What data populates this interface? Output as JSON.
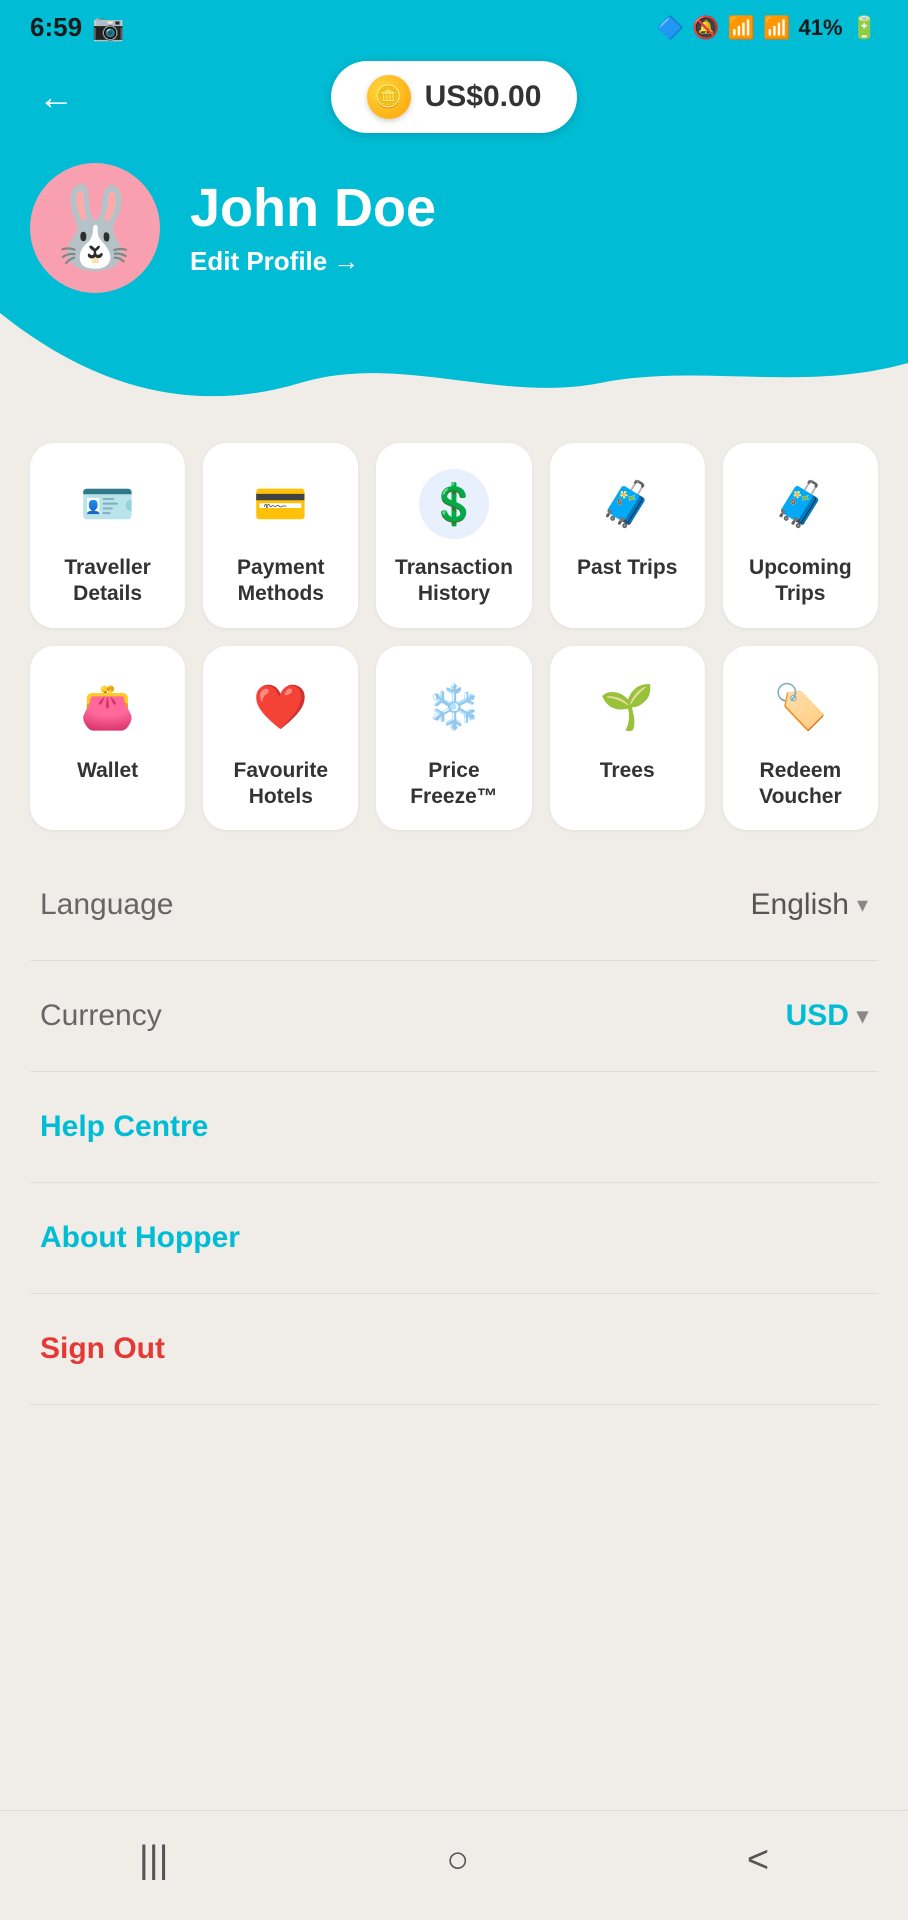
{
  "statusBar": {
    "time": "6:59",
    "battery": "41%"
  },
  "header": {
    "balance": "US$0.00",
    "backLabel": "←"
  },
  "profile": {
    "name": "John Doe",
    "editLabel": "Edit Profile",
    "editArrow": "→"
  },
  "menuItems": [
    {
      "id": "traveller-details",
      "label": "Traveller Details",
      "icon": "🪪"
    },
    {
      "id": "payment-methods",
      "label": "Payment Methods",
      "icon": "💳"
    },
    {
      "id": "transaction-history",
      "label": "Transaction History",
      "icon": "💱"
    },
    {
      "id": "past-trips",
      "label": "Past Trips",
      "icon": "🧳"
    },
    {
      "id": "upcoming-trips",
      "label": "Upcoming Trips",
      "icon": "🧳"
    },
    {
      "id": "wallet",
      "label": "Wallet",
      "icon": "👛"
    },
    {
      "id": "favourite-hotels",
      "label": "Favourite Hotels",
      "icon": "❤️"
    },
    {
      "id": "price-freeze",
      "label": "Price Freeze™",
      "icon": "❄️"
    },
    {
      "id": "trees",
      "label": "Trees",
      "icon": "🌱"
    },
    {
      "id": "redeem-voucher",
      "label": "Redeem Voucher",
      "icon": "🏷️"
    }
  ],
  "settings": {
    "languageLabel": "Language",
    "languageValue": "English",
    "currencyLabel": "Currency",
    "currencyValue": "USD"
  },
  "links": {
    "helpCentre": "Help Centre",
    "aboutHopper": "About Hopper",
    "signOut": "Sign Out"
  },
  "bottomNav": {
    "recentApps": "|||",
    "home": "○",
    "back": "<"
  }
}
